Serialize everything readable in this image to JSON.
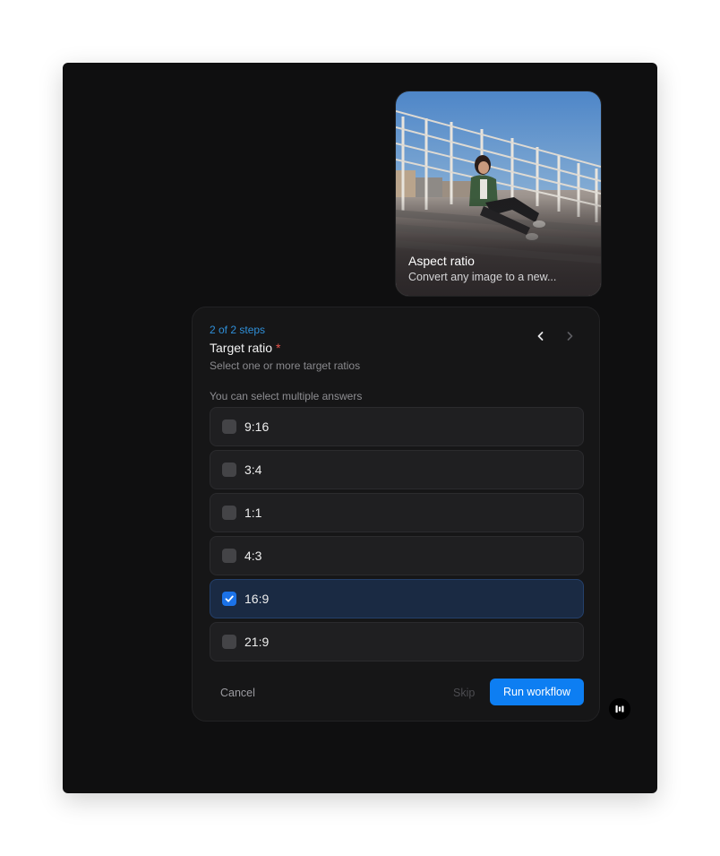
{
  "workflow_card": {
    "title": "Aspect ratio",
    "description": "Convert any image to a new..."
  },
  "question": {
    "step_indicator": "2 of 2 steps",
    "title": "Target ratio",
    "required_mark": "*",
    "subtitle": "Select one or more target ratios",
    "helper_text": "You can select multiple answers",
    "options": [
      {
        "label": "9:16",
        "selected": false
      },
      {
        "label": "3:4",
        "selected": false
      },
      {
        "label": "1:1",
        "selected": false
      },
      {
        "label": "4:3",
        "selected": false
      },
      {
        "label": "16:9",
        "selected": true
      },
      {
        "label": "21:9",
        "selected": false
      }
    ]
  },
  "navigation": {
    "prev_icon": "chevron-left-icon",
    "next_icon": "chevron-right-icon"
  },
  "actions": {
    "cancel_label": "Cancel",
    "skip_label": "Skip",
    "run_label": "Run workflow"
  },
  "colors": {
    "accent": "#0d7ef2",
    "step_indicator": "#2f8fd8",
    "required": "#e5534b",
    "selected_row": "#1a2a43"
  }
}
